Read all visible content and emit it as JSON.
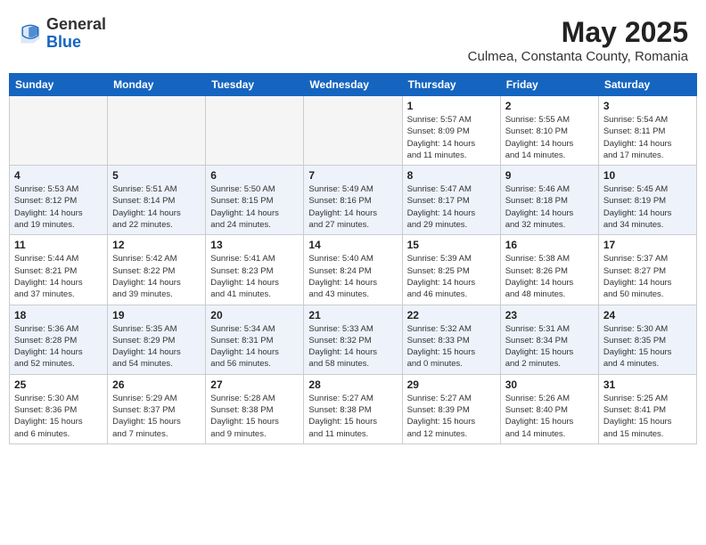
{
  "header": {
    "logo_general": "General",
    "logo_blue": "Blue",
    "month_year": "May 2025",
    "location": "Culmea, Constanta County, Romania"
  },
  "weekdays": [
    "Sunday",
    "Monday",
    "Tuesday",
    "Wednesday",
    "Thursday",
    "Friday",
    "Saturday"
  ],
  "weeks": [
    [
      {
        "day": "",
        "detail": ""
      },
      {
        "day": "",
        "detail": ""
      },
      {
        "day": "",
        "detail": ""
      },
      {
        "day": "",
        "detail": ""
      },
      {
        "day": "1",
        "detail": "Sunrise: 5:57 AM\nSunset: 8:09 PM\nDaylight: 14 hours\nand 11 minutes."
      },
      {
        "day": "2",
        "detail": "Sunrise: 5:55 AM\nSunset: 8:10 PM\nDaylight: 14 hours\nand 14 minutes."
      },
      {
        "day": "3",
        "detail": "Sunrise: 5:54 AM\nSunset: 8:11 PM\nDaylight: 14 hours\nand 17 minutes."
      }
    ],
    [
      {
        "day": "4",
        "detail": "Sunrise: 5:53 AM\nSunset: 8:12 PM\nDaylight: 14 hours\nand 19 minutes."
      },
      {
        "day": "5",
        "detail": "Sunrise: 5:51 AM\nSunset: 8:14 PM\nDaylight: 14 hours\nand 22 minutes."
      },
      {
        "day": "6",
        "detail": "Sunrise: 5:50 AM\nSunset: 8:15 PM\nDaylight: 14 hours\nand 24 minutes."
      },
      {
        "day": "7",
        "detail": "Sunrise: 5:49 AM\nSunset: 8:16 PM\nDaylight: 14 hours\nand 27 minutes."
      },
      {
        "day": "8",
        "detail": "Sunrise: 5:47 AM\nSunset: 8:17 PM\nDaylight: 14 hours\nand 29 minutes."
      },
      {
        "day": "9",
        "detail": "Sunrise: 5:46 AM\nSunset: 8:18 PM\nDaylight: 14 hours\nand 32 minutes."
      },
      {
        "day": "10",
        "detail": "Sunrise: 5:45 AM\nSunset: 8:19 PM\nDaylight: 14 hours\nand 34 minutes."
      }
    ],
    [
      {
        "day": "11",
        "detail": "Sunrise: 5:44 AM\nSunset: 8:21 PM\nDaylight: 14 hours\nand 37 minutes."
      },
      {
        "day": "12",
        "detail": "Sunrise: 5:42 AM\nSunset: 8:22 PM\nDaylight: 14 hours\nand 39 minutes."
      },
      {
        "day": "13",
        "detail": "Sunrise: 5:41 AM\nSunset: 8:23 PM\nDaylight: 14 hours\nand 41 minutes."
      },
      {
        "day": "14",
        "detail": "Sunrise: 5:40 AM\nSunset: 8:24 PM\nDaylight: 14 hours\nand 43 minutes."
      },
      {
        "day": "15",
        "detail": "Sunrise: 5:39 AM\nSunset: 8:25 PM\nDaylight: 14 hours\nand 46 minutes."
      },
      {
        "day": "16",
        "detail": "Sunrise: 5:38 AM\nSunset: 8:26 PM\nDaylight: 14 hours\nand 48 minutes."
      },
      {
        "day": "17",
        "detail": "Sunrise: 5:37 AM\nSunset: 8:27 PM\nDaylight: 14 hours\nand 50 minutes."
      }
    ],
    [
      {
        "day": "18",
        "detail": "Sunrise: 5:36 AM\nSunset: 8:28 PM\nDaylight: 14 hours\nand 52 minutes."
      },
      {
        "day": "19",
        "detail": "Sunrise: 5:35 AM\nSunset: 8:29 PM\nDaylight: 14 hours\nand 54 minutes."
      },
      {
        "day": "20",
        "detail": "Sunrise: 5:34 AM\nSunset: 8:31 PM\nDaylight: 14 hours\nand 56 minutes."
      },
      {
        "day": "21",
        "detail": "Sunrise: 5:33 AM\nSunset: 8:32 PM\nDaylight: 14 hours\nand 58 minutes."
      },
      {
        "day": "22",
        "detail": "Sunrise: 5:32 AM\nSunset: 8:33 PM\nDaylight: 15 hours\nand 0 minutes."
      },
      {
        "day": "23",
        "detail": "Sunrise: 5:31 AM\nSunset: 8:34 PM\nDaylight: 15 hours\nand 2 minutes."
      },
      {
        "day": "24",
        "detail": "Sunrise: 5:30 AM\nSunset: 8:35 PM\nDaylight: 15 hours\nand 4 minutes."
      }
    ],
    [
      {
        "day": "25",
        "detail": "Sunrise: 5:30 AM\nSunset: 8:36 PM\nDaylight: 15 hours\nand 6 minutes."
      },
      {
        "day": "26",
        "detail": "Sunrise: 5:29 AM\nSunset: 8:37 PM\nDaylight: 15 hours\nand 7 minutes."
      },
      {
        "day": "27",
        "detail": "Sunrise: 5:28 AM\nSunset: 8:38 PM\nDaylight: 15 hours\nand 9 minutes."
      },
      {
        "day": "28",
        "detail": "Sunrise: 5:27 AM\nSunset: 8:38 PM\nDaylight: 15 hours\nand 11 minutes."
      },
      {
        "day": "29",
        "detail": "Sunrise: 5:27 AM\nSunset: 8:39 PM\nDaylight: 15 hours\nand 12 minutes."
      },
      {
        "day": "30",
        "detail": "Sunrise: 5:26 AM\nSunset: 8:40 PM\nDaylight: 15 hours\nand 14 minutes."
      },
      {
        "day": "31",
        "detail": "Sunrise: 5:25 AM\nSunset: 8:41 PM\nDaylight: 15 hours\nand 15 minutes."
      }
    ]
  ]
}
